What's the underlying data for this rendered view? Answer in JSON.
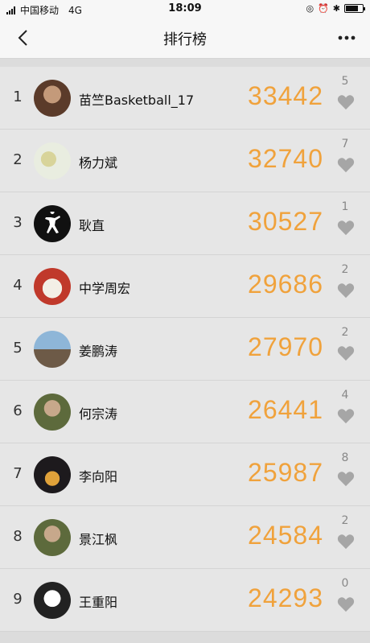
{
  "status": {
    "carrier": "中国移动",
    "network": "4G",
    "time": "18:09"
  },
  "header": {
    "title": "排行榜"
  },
  "colors": {
    "score": "#f0a23c",
    "heart": "#a6a6a6",
    "background": "#e6e6e6"
  },
  "rows": [
    {
      "rank": "1",
      "name": "苗竺Basketball_17",
      "score": "33442",
      "likes": "5",
      "avatar": "photo-portrait"
    },
    {
      "rank": "2",
      "name": "杨力斌",
      "score": "32740",
      "likes": "7",
      "avatar": "cartoon-illustration"
    },
    {
      "rank": "3",
      "name": "耿直",
      "score": "30527",
      "likes": "1",
      "avatar": "jumpman-logo"
    },
    {
      "rank": "4",
      "name": "中学周宏",
      "score": "29686",
      "likes": "2",
      "avatar": "cake-photo"
    },
    {
      "rank": "5",
      "name": "姜鹏涛",
      "score": "27970",
      "likes": "2",
      "avatar": "landscape-photo"
    },
    {
      "rank": "6",
      "name": "何宗涛",
      "score": "26441",
      "likes": "4",
      "avatar": "person-photo"
    },
    {
      "rank": "7",
      "name": "李向阳",
      "score": "25987",
      "likes": "8",
      "avatar": "night-tower-photo"
    },
    {
      "rank": "8",
      "name": "景江枫",
      "score": "24584",
      "likes": "2",
      "avatar": "person-photo"
    },
    {
      "rank": "9",
      "name": "王重阳",
      "score": "24293",
      "likes": "0",
      "avatar": "panda-cartoon"
    }
  ]
}
